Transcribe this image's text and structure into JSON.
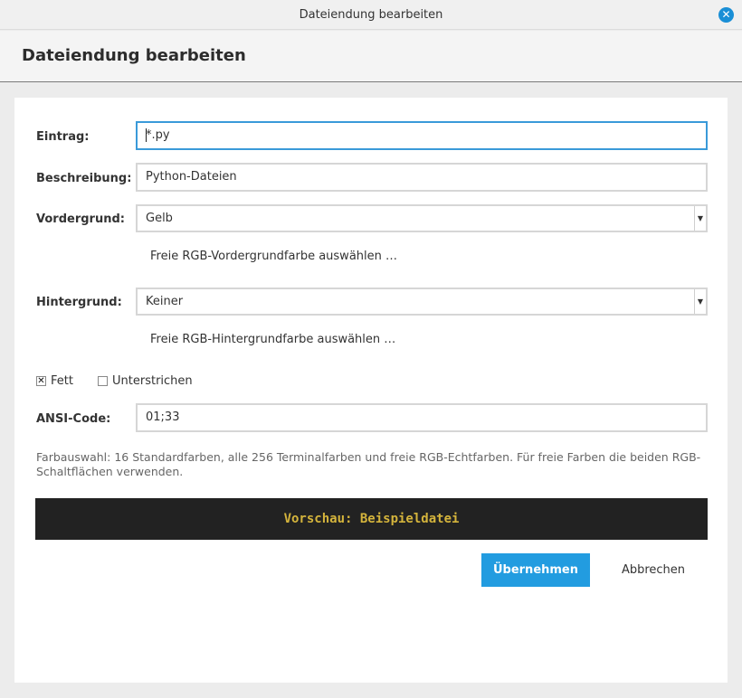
{
  "window": {
    "title": "Dateiendung bearbeiten",
    "close_icon": "close-icon"
  },
  "header": {
    "title": "Dateiendung bearbeiten"
  },
  "form": {
    "entry_label": "Eintrag:",
    "entry_value": "*.py",
    "description_label": "Beschreibung:",
    "description_value": "Python-Dateien",
    "foreground_label": "Vordergrund:",
    "foreground_value": "Gelb",
    "foreground_rgb_button": "Freie RGB-Vordergrundfarbe auswählen …",
    "background_label": "Hintergrund:",
    "background_value": "Keiner",
    "background_rgb_button": "Freie RGB-Hintergrundfarbe auswählen …",
    "bold_label": "Fett",
    "bold_checked": true,
    "underline_label": "Unterstrichen",
    "underline_checked": false,
    "ansi_label": "ANSI-Code:",
    "ansi_value": "01;33",
    "hint": "Farbauswahl: 16 Standardfarben, alle 256 Terminalfarben und freie RGB-Echtfarben. Für freie Farben die beiden RGB-Schaltflächen verwenden."
  },
  "preview": {
    "text": "Vorschau: Beispieldatei",
    "fg_color": "#d4b43c",
    "bg_color": "#222222"
  },
  "actions": {
    "apply": "Übernehmen",
    "cancel": "Abbrechen"
  },
  "colors": {
    "accent": "#229ce0",
    "focus_border": "#3a9ad9"
  }
}
